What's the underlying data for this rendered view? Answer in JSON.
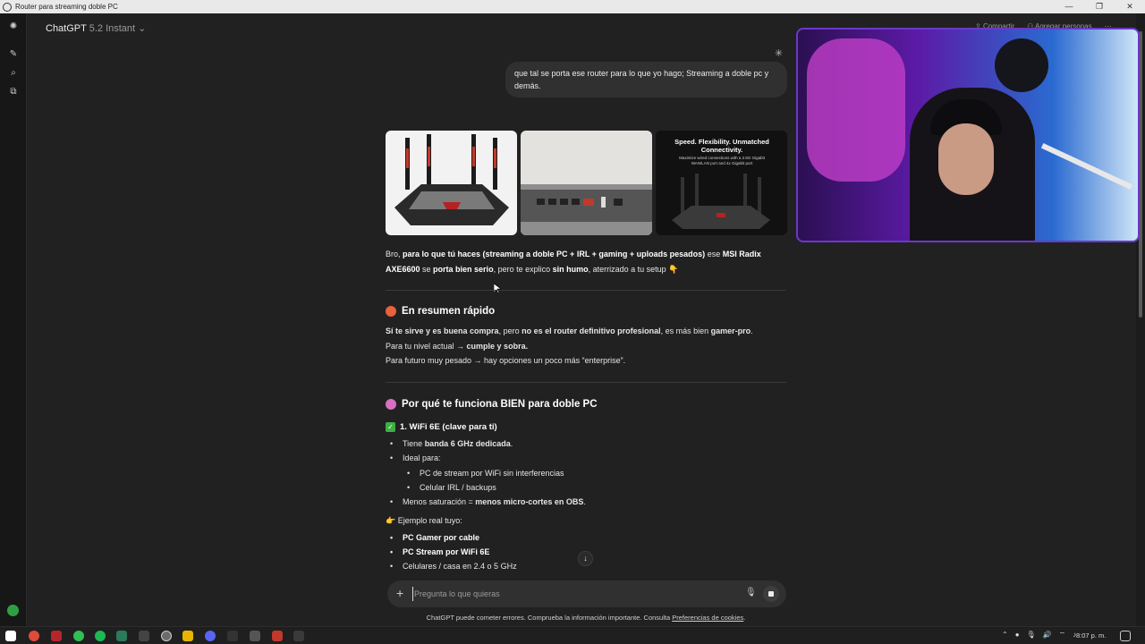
{
  "window": {
    "title": "Router para streaming doble PC"
  },
  "header": {
    "model_name": "ChatGPT",
    "model_version": "5.2 Instant",
    "share_label": "Compartir",
    "add_people_label": "Agregar personas"
  },
  "user_message": "que tal se porta ese router para lo que yo hago; Streaming a doble pc y demás.",
  "images": {
    "card3_title": "Speed. Flexibility. Unmatched Connectivity.",
    "card3_sub": "Maximize wired connections with a 2.5G Gigabit WAN/LAN port and 4x Gigabit port"
  },
  "answer": {
    "intro_a": "Bro, ",
    "intro_b": "para lo que tú haces (streaming a doble PC + IRL + gaming + uploads pesados)",
    "intro_c": " ese ",
    "intro_d": "MSI Radix AXE6600",
    "intro_e": " se ",
    "intro_f": "porta bien serio",
    "intro_g": ", pero te explico ",
    "intro_h": "sin humo",
    "intro_i": ", aterrizado a tu setup 👇",
    "summary_heading": "En resumen rápido",
    "summary_l1_a": "Sí te sirve y es buena compra",
    "summary_l1_b": ", pero ",
    "summary_l1_c": "no es el router definitivo profesional",
    "summary_l1_d": ", es más bien ",
    "summary_l1_e": "gamer-pro",
    "summary_l1_f": ".",
    "summary_l2_a": "Para tu nivel actual → ",
    "summary_l2_b": "cumple y sobra.",
    "summary_l3": "Para futuro muy pesado → hay opciones un poco más “enterprise”.",
    "why_heading": "Por qué te funciona BIEN para doble PC",
    "wifi_heading": "1. WiFi 6E (clave para ti)",
    "b1_a": "Tiene ",
    "b1_b": "banda 6 GHz dedicada",
    "b1_c": ".",
    "b2": "Ideal para:",
    "b2_1": "PC de stream por WiFi sin interferencias",
    "b2_2": "Celular IRL / backups",
    "b3_a": "Menos saturación = ",
    "b3_b": "menos micro-cortes en OBS",
    "b3_c": ".",
    "example_label": "👉 Ejemplo real tuyo:",
    "e1": "PC Gamer por cable",
    "e2": "PC Stream por WiFi 6E",
    "e3": "Celulares / casa en 2.4 o 5 GHz"
  },
  "composer": {
    "placeholder": "Pregunta lo que quieras"
  },
  "disclaimer": {
    "text": "ChatGPT puede cometer errores. Comprueba la información importante. Consulta ",
    "link": "Preferencias de cookies",
    "end": "."
  },
  "taskbar": {
    "clock": "8:07 p. m."
  },
  "colors": {
    "accent_green": "#3cb043",
    "bg": "#212121",
    "bubble": "#303030"
  }
}
